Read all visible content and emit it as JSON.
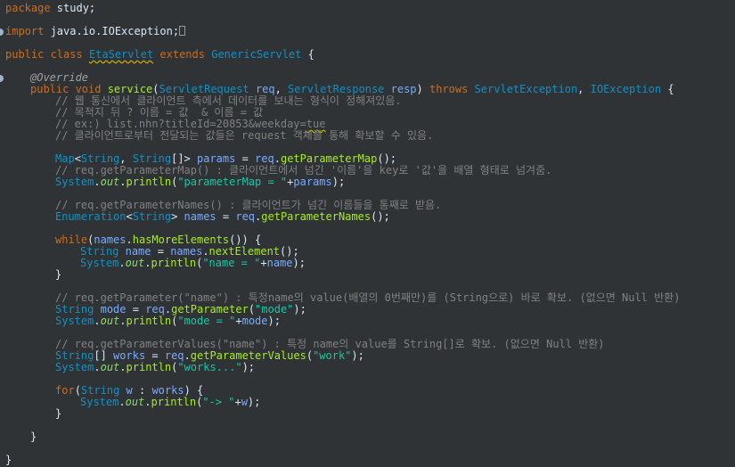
{
  "editor": {
    "background": "#2f3336",
    "line1": {
      "kw": "package",
      "name": " study;"
    },
    "line2": {
      "kw": "import",
      "name": " java.io.IOException;"
    },
    "line3": {
      "kw1": "public",
      "kw2": " class ",
      "cls": "EtaServlet",
      "kw3": " extends ",
      "parent": "GenericServlet",
      "brace": " {"
    },
    "line4": {
      "annotation": "@Override"
    },
    "line5": {
      "kw": "public void ",
      "method": "service",
      "p1": "(",
      "t1": "ServletRequest",
      "v1": " req",
      "c1": ", ",
      "t2": "ServletResponse",
      "v2": " resp",
      "p2": ") ",
      "kw2": "throws",
      "sp": " ",
      "e1": "ServletException",
      "c2": ", ",
      "e2": "IOException",
      "brace": " {"
    },
    "comment1": "// 웹 통신에서 클라이언트 측에서 데이터를 보내는 형식이 정해져있음.",
    "comment2": "// 목적지 뒤 ? 이름 = 값  & 이름 = 값",
    "comment3a": "// ex:) list.nhn?titleId=20853&weekday=",
    "comment3b": "tue",
    "comment4": "// 클라이언트로부터 전달되는 값들은 request 객체를 통해 확보할 수 있음.",
    "l10": {
      "t1": "Map",
      "a": "<",
      "t2": "String",
      "b": ", ",
      "t3": "String",
      "c": "[]> ",
      "v": "params",
      "d": " = ",
      "r": "req",
      "e": ".",
      "m": "getParameterMap",
      "f": "();"
    },
    "comment5": "// req.getParameterMap() : 클라이언트에서 넘긴 '이름'을 key로 '값'을 배열 형태로 넘겨줌.",
    "l12": {
      "t": "System",
      "a": ".",
      "fld": "out",
      "b": ".",
      "m": "println",
      "c": "(",
      "s": "\"parameterMap = \"",
      "d": "+",
      "v": "params",
      "e": ");"
    },
    "comment6": "// req.getParameterNames() : 클라이언트가 넘긴 이름들을 통째로 받음.",
    "l15": {
      "t1": "Enumeration",
      "a": "<",
      "t2": "String",
      "b": "> ",
      "v": "names",
      "c": " = ",
      "r": "req",
      "d": ".",
      "m": "getParameterNames",
      "e": "();"
    },
    "l17": {
      "kw": "while",
      "a": "(",
      "v": "names",
      "b": ".",
      "m": "hasMoreElements",
      "c": "()) {"
    },
    "l18": {
      "t": "String",
      "sp": " ",
      "v": "name",
      "a": " = ",
      "v2": "names",
      "b": ".",
      "m": "nextElement",
      "c": "();"
    },
    "l19": {
      "t": "System",
      "a": ".",
      "fld": "out",
      "b": ".",
      "m": "println",
      "c": "(",
      "s": "\"name = \"",
      "d": "+",
      "v": "name",
      "e": ");"
    },
    "l20": {
      "brace": "}"
    },
    "comment7": "// req.getParameter(\"name\") : 특정name의 value(배열의 0번째만)를 (String으로) 바로 확보. (없으면 Null 반환)",
    "l23": {
      "t": "String",
      "sp": " ",
      "v": "mode",
      "a": " = ",
      "r": "req",
      "b": ".",
      "m": "getParameter",
      "c": "(",
      "s": "\"mode\"",
      "d": ");"
    },
    "l24": {
      "t": "System",
      "a": ".",
      "fld": "out",
      "b": ".",
      "m": "println",
      "c": "(",
      "s": "\"mode = \"",
      "d": "+",
      "v": "mode",
      "e": ");"
    },
    "comment8": "// req.getParameterValues(\"name\") : 특정 name의 value를 String[]로 확보. (없으면 Null 반환)",
    "l27": {
      "t": "String",
      "a": "[] ",
      "v": "works",
      "b": " = ",
      "r": "req",
      "c": ".",
      "m": "getParameterValues",
      "d": "(",
      "s": "\"work\"",
      "e": ");"
    },
    "l28": {
      "t": "System",
      "a": ".",
      "fld": "out",
      "b": ".",
      "m": "println",
      "c": "(",
      "s": "\"works...\"",
      "d": ");"
    },
    "l30": {
      "kw": "for",
      "a": "(",
      "t": "String",
      "sp": " ",
      "v": "w",
      "b": " : ",
      "v2": "works",
      "c": ") {"
    },
    "l31": {
      "t": "System",
      "a": ".",
      "fld": "out",
      "b": ".",
      "m": "println",
      "c": "(",
      "s": "\"-> \"",
      "d": "+",
      "v": "w",
      "e": ");"
    },
    "l32": {
      "brace": "}"
    },
    "l34": {
      "brace": "}"
    },
    "l36": {
      "brace": "}"
    }
  }
}
